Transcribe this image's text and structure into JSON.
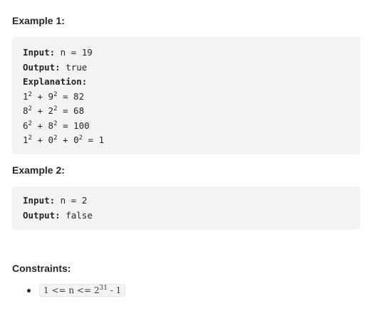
{
  "example1": {
    "heading": "Example 1:",
    "input_label": "Input:",
    "input_value": " n = 19",
    "output_label": "Output:",
    "output_value": " true",
    "explanation_label": "Explanation:",
    "steps": [
      {
        "a": "1",
        "b": "9",
        "result": " = 82"
      },
      {
        "a": "8",
        "b": "2",
        "result": " = 68"
      },
      {
        "a": "6",
        "b": "8",
        "result": " = 100"
      }
    ],
    "final_step": {
      "a": "1",
      "b": "0",
      "c": "0",
      "result": " = 1"
    },
    "exponent": "2",
    "plus": " + "
  },
  "example2": {
    "heading": "Example 2:",
    "input_label": "Input:",
    "input_value": " n = 2",
    "output_label": "Output:",
    "output_value": " false"
  },
  "constraints": {
    "heading": "Constraints:",
    "item": {
      "prefix": "1 <= n <= 2",
      "exponent": "31",
      "suffix": " - 1"
    }
  }
}
